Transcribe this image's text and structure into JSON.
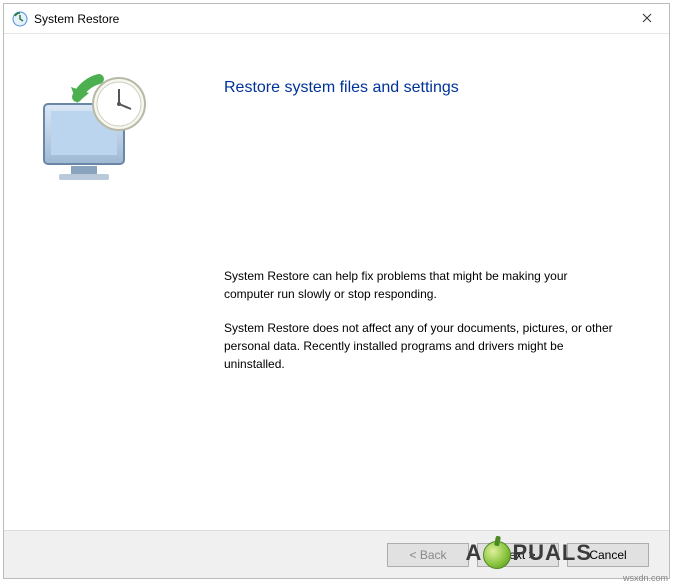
{
  "window": {
    "title": "System Restore"
  },
  "content": {
    "heading": "Restore system files and settings",
    "paragraph1": "System Restore can help fix problems that might be making your computer run slowly or stop responding.",
    "paragraph2": "System Restore does not affect any of your documents, pictures, or other personal data. Recently installed programs and drivers might be uninstalled."
  },
  "buttons": {
    "back": "< Back",
    "next": "Next >",
    "cancel": "Cancel"
  },
  "overlay": {
    "brand_prefix": "A",
    "brand_suffix": "PUALS",
    "watermark": "wsxdn.com"
  }
}
